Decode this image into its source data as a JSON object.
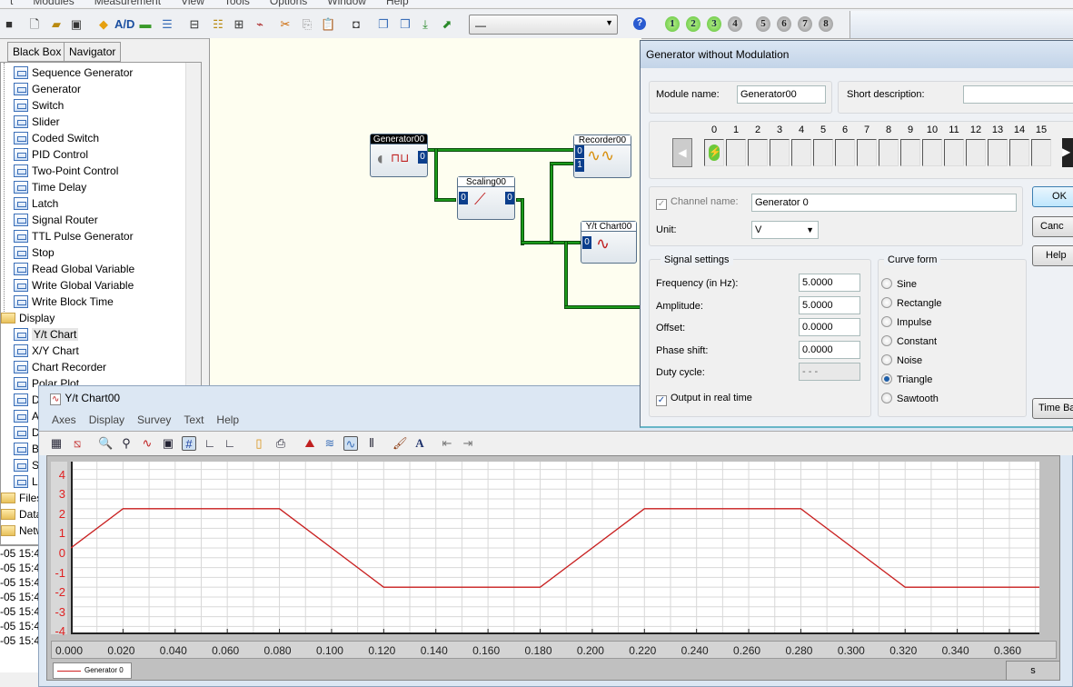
{
  "menubar": [
    "t",
    "Modules",
    "Measurement",
    "View",
    "Tools",
    "Options",
    "Window",
    "Help"
  ],
  "toolbar": {
    "combo_value": "—",
    "help": "?",
    "sheets": [
      {
        "n": "1",
        "active": true
      },
      {
        "n": "2",
        "active": true
      },
      {
        "n": "3",
        "active": true
      },
      {
        "n": "4",
        "active": false
      },
      {
        "n": "5",
        "active": false
      },
      {
        "n": "6",
        "active": false
      },
      {
        "n": "7",
        "active": false
      },
      {
        "n": "8",
        "active": false
      }
    ]
  },
  "left_panel": {
    "tabs": [
      "Black Box",
      "Navigator"
    ],
    "items": [
      {
        "label": "Sequence Generator",
        "type": "module"
      },
      {
        "label": "Generator",
        "type": "module"
      },
      {
        "label": "Switch",
        "type": "module"
      },
      {
        "label": "Slider",
        "type": "module"
      },
      {
        "label": "Coded Switch",
        "type": "module"
      },
      {
        "label": "PID Control",
        "type": "module"
      },
      {
        "label": "Two-Point Control",
        "type": "module"
      },
      {
        "label": "Time Delay",
        "type": "module"
      },
      {
        "label": "Latch",
        "type": "module"
      },
      {
        "label": "Signal Router",
        "type": "module"
      },
      {
        "label": "TTL Pulse Generator",
        "type": "module"
      },
      {
        "label": "Stop",
        "type": "module"
      },
      {
        "label": "Read Global Variable",
        "type": "module"
      },
      {
        "label": "Write Global Variable",
        "type": "module"
      },
      {
        "label": "Write Block Time",
        "type": "module"
      },
      {
        "label": "Display",
        "type": "folder"
      },
      {
        "label": "Y/t Chart",
        "type": "module",
        "selected": true
      },
      {
        "label": "X/Y Chart",
        "type": "module"
      },
      {
        "label": "Chart Recorder",
        "type": "module"
      },
      {
        "label": "Polar Plot",
        "type": "module"
      },
      {
        "label": "D",
        "type": "module"
      },
      {
        "label": "A",
        "type": "module"
      },
      {
        "label": "D",
        "type": "module"
      },
      {
        "label": "B",
        "type": "module"
      },
      {
        "label": "S",
        "type": "module"
      },
      {
        "label": "L",
        "type": "module"
      },
      {
        "label": "Files",
        "type": "folder"
      },
      {
        "label": "Data",
        "type": "folder"
      },
      {
        "label": "Netw",
        "type": "folder"
      }
    ],
    "log": [
      "-05 15:4",
      "-05 15:4",
      "-05 15:4",
      "-05 15:4",
      "-05 15:4",
      "-05 15:4",
      "-05 15:4"
    ]
  },
  "canvas": {
    "modules": {
      "generator": "Generator00",
      "scaling": "Scaling00",
      "recorder": "Recorder00",
      "ytchart": "Y/t Chart00"
    },
    "ports": {
      "p0": "0",
      "p1": "1"
    }
  },
  "dialog": {
    "title": "Generator without Modulation",
    "module_name_label": "Module name:",
    "module_name": "Generator00",
    "short_desc_label": "Short description:",
    "short_desc": "",
    "channels": [
      "0",
      "1",
      "2",
      "3",
      "4",
      "5",
      "6",
      "7",
      "8",
      "9",
      "10",
      "11",
      "12",
      "13",
      "14",
      "15"
    ],
    "active_channel": "0",
    "channel_name_label": "Channel name:",
    "channel_name": "Generator 0",
    "unit_label": "Unit:",
    "unit": "V",
    "signal_settings": {
      "title": "Signal settings",
      "fields": [
        {
          "label": "Frequency (in Hz):",
          "value": "5.0000"
        },
        {
          "label": "Amplitude:",
          "value": "5.0000"
        },
        {
          "label": "Offset:",
          "value": "0.0000"
        },
        {
          "label": "Phase shift:",
          "value": "0.0000"
        },
        {
          "label": "Duty cycle:",
          "value": "- - -",
          "disabled": true
        }
      ],
      "realtime_label": "Output in real time",
      "realtime": true
    },
    "curve_form": {
      "title": "Curve form",
      "options": [
        "Sine",
        "Rectangle",
        "Impulse",
        "Constant",
        "Noise",
        "Triangle",
        "Sawtooth"
      ],
      "selected": "Triangle"
    },
    "buttons": {
      "ok": "OK",
      "cancel": "Canc",
      "help": "Help",
      "timebase": "Time Ba"
    }
  },
  "chart_window": {
    "title": "Y/t Chart00",
    "menu": [
      "Axes",
      "Display",
      "Survey",
      "Text",
      "Help"
    ],
    "unit": "s",
    "legend": "Generator 0"
  },
  "chart_data": {
    "type": "line",
    "title": "",
    "xlabel": "s",
    "ylabel": "",
    "xlim": [
      0,
      0.3715
    ],
    "ylim": [
      -4.4,
      4.4
    ],
    "grid": true,
    "x_ticks": [
      "0.000",
      "0.020",
      "0.040",
      "0.060",
      "0.080",
      "0.100",
      "0.120",
      "0.140",
      "0.160",
      "0.180",
      "0.200",
      "0.220",
      "0.240",
      "0.260",
      "0.280",
      "0.300",
      "0.320",
      "0.340",
      "0.360"
    ],
    "y_ticks": [
      "4",
      "3",
      "2",
      "1",
      "0",
      "-1",
      "-2",
      "-3",
      "-4"
    ],
    "legend_position": "bottom-left",
    "series": [
      {
        "name": "Generator 0",
        "color": "#c81e1e",
        "x": [
          0,
          0.02,
          0.08,
          0.12,
          0.18,
          0.22,
          0.28,
          0.32,
          0.3715
        ],
        "y": [
          0,
          2,
          2,
          -2,
          -2,
          2,
          2,
          -2,
          -2
        ]
      }
    ]
  }
}
